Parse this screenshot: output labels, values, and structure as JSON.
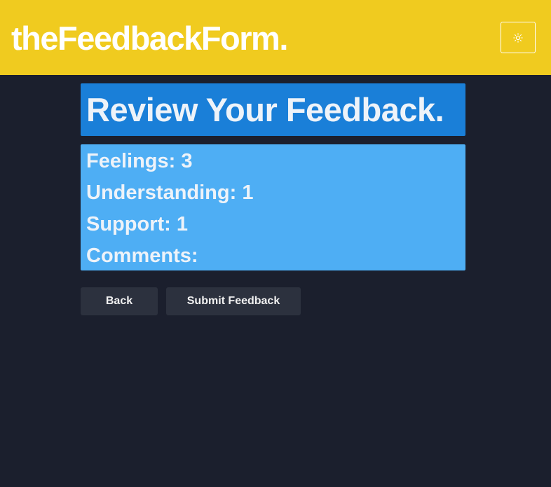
{
  "header": {
    "brand": "theFeedbackForm.",
    "theme_toggle_icon": "sun-icon"
  },
  "review": {
    "title": "Review Your Feedback.",
    "items": [
      {
        "label": "Feelings:",
        "value": "3"
      },
      {
        "label": "Understanding:",
        "value": "1"
      },
      {
        "label": "Support:",
        "value": "1"
      },
      {
        "label": "Comments:",
        "value": ""
      }
    ]
  },
  "actions": {
    "back_label": "Back",
    "submit_label": "Submit Feedback"
  },
  "colors": {
    "header_bg": "#f0cb1f",
    "page_bg": "#1b1f2d",
    "title_bg": "#1a7fd8",
    "review_bg": "#4eaef4",
    "button_bg": "#2c313e"
  }
}
